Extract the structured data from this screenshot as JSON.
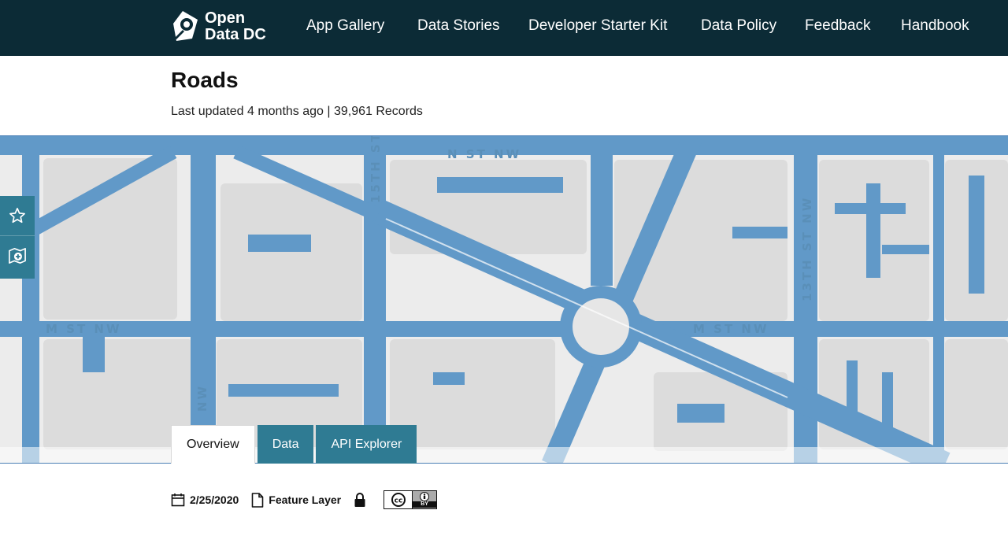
{
  "brand": {
    "name_line1": "Open",
    "name_line2": "Data DC",
    "nav_bg": "#0c2b36",
    "accent": "#2f7b93",
    "road_color": "#6199c8"
  },
  "nav": {
    "items": [
      {
        "label": "App Gallery"
      },
      {
        "label": "Data Stories"
      },
      {
        "label": "Developer Starter Kit"
      },
      {
        "label": "Data Policy"
      },
      {
        "label": "Feedback"
      },
      {
        "label": "Handbook"
      }
    ]
  },
  "dataset": {
    "title": "Roads",
    "meta": "Last updated 4 months ago | 39,961 Records"
  },
  "map": {
    "street_labels": {
      "n_st": "N ST NW",
      "m_st_left": "M ST NW",
      "m_st_right": "M ST NW",
      "st_15th": "15TH ST",
      "st_13th": "13TH ST NW",
      "nw_vertical": "NW"
    },
    "tools": [
      {
        "icon": "star-icon"
      },
      {
        "icon": "add-to-map-icon"
      }
    ]
  },
  "tabs": [
    {
      "label": "Overview",
      "active": true
    },
    {
      "label": "Data",
      "active": false
    },
    {
      "label": "API Explorer",
      "active": false
    }
  ],
  "info": {
    "date": "2/25/2020",
    "type": "Feature Layer",
    "license_icon": "cc-by-icon",
    "cc_by_text": "BY"
  }
}
